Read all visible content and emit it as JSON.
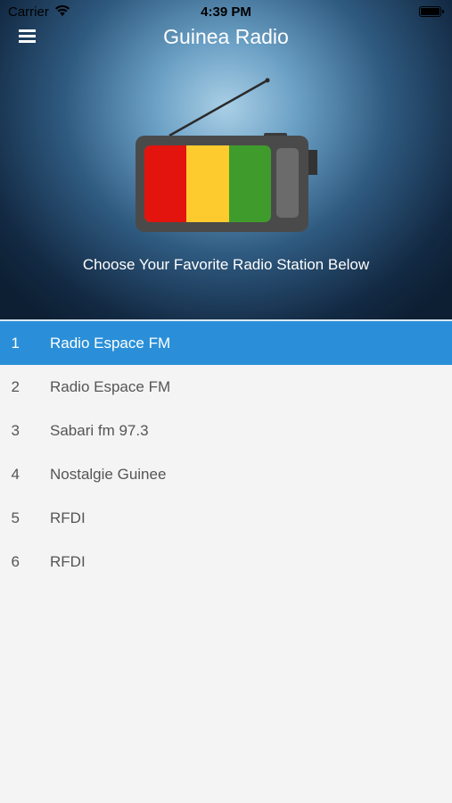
{
  "status_bar": {
    "carrier": "Carrier",
    "time": "4:39 PM"
  },
  "header": {
    "title": "Guinea Radio",
    "menu_icon": "hamburger-menu-icon",
    "tagline": "Choose Your Favorite Radio Station Below",
    "flag_colors": [
      "#e3130e",
      "#fecb2e",
      "#3f9c2c"
    ]
  },
  "stations": [
    {
      "number": "1",
      "name": "Radio Espace FM",
      "selected": true
    },
    {
      "number": "2",
      "name": "Radio Espace FM",
      "selected": false
    },
    {
      "number": "3",
      "name": "Sabari fm 97.3",
      "selected": false
    },
    {
      "number": "4",
      "name": "Nostalgie Guinee",
      "selected": false
    },
    {
      "number": "5",
      "name": "RFDI",
      "selected": false
    },
    {
      "number": "6",
      "name": "RFDI",
      "selected": false
    }
  ],
  "colors": {
    "accent": "#2a8fd8",
    "list_background": "#f4f4f4"
  }
}
